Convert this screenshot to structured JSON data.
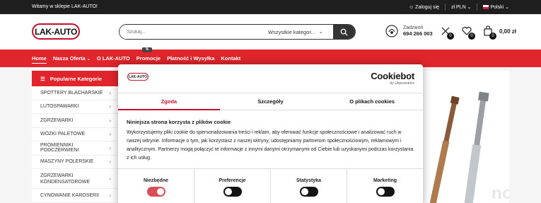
{
  "topbar": {
    "welcome": "Witamy w sklepie LAK-AUTO!",
    "login": "Zaloguj się",
    "currency": "zł PLN",
    "language": "Polski"
  },
  "header": {
    "logo_text": "LAK-AUTO",
    "search_placeholder": "Szukaj...",
    "search_category": "Wszystkie kategor...",
    "phone_label": "Zadzwoń",
    "phone_number": "694 266 003",
    "compare_count": "0",
    "wishlist_count": "0",
    "cart_count": "0",
    "cart_value": "0,00 zł"
  },
  "nav": {
    "items": [
      "Home",
      "Nasza Oferta",
      "O LAK-AUTO",
      "Promocje",
      "Płatność i Wysyłka",
      "Kontakt"
    ],
    "promo_tag": "%"
  },
  "sidebar": {
    "title": "Popularne Kategorie",
    "items": [
      "SPOTTERY BLACHARSKIE",
      "LUTOSPAWARKI",
      "ZGRZEWARKI",
      "WÓZKI PALETOWE",
      "PROMIENNIKI PODCZERWIENI",
      "MASZYNY POLERSKIE",
      "ZGRZEWARKI KONDENSATOROWE",
      "CYNOWANIE KAROSERII"
    ]
  },
  "watermark": "nowposzukasc.pl",
  "cookie": {
    "logo_text": "LAK-AUTO",
    "brand": "Cookiebot",
    "brand_by": "by Usercentrics",
    "tabs": [
      "Zgoda",
      "Szczegóły",
      "O plikach cookies"
    ],
    "title": "Niniejsza strona korzysta z plików cookie",
    "text": "Wykorzystujemy pliki cookie do spersonalizowania treści i reklam, aby oferować funkcje społecznościowe i analizować ruch w naszej witrynie. Informacje o tym, jak korzystasz z naszej witryny, udostępniamy partnerom społecznościowym, reklamowym i analitycznym. Partnerzy mogą połączyć te informacje z innymi danymi otrzymanymi od Ciebie lub uzyskanymi podczas korzystania z ich usług.",
    "toggles": [
      "Niezbędne",
      "Preferencje",
      "Statystyka",
      "Marketing"
    ]
  },
  "colors": {
    "brand_red": "#e0252c",
    "dark": "#1e1e1e"
  }
}
